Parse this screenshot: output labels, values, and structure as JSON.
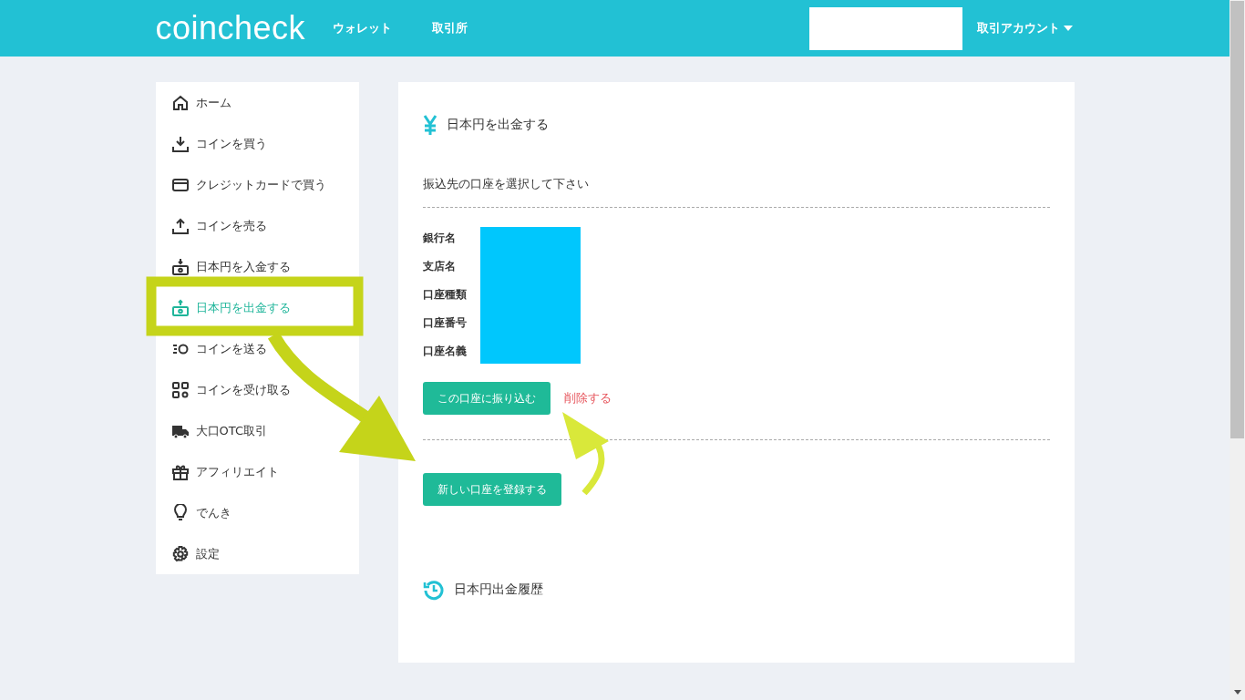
{
  "header": {
    "logo": "coincheck",
    "nav": [
      {
        "label": "ウォレット"
      },
      {
        "label": "取引所"
      }
    ],
    "account_menu": "取引アカウント"
  },
  "sidebar": {
    "items": [
      {
        "kind": "home",
        "label": "ホーム",
        "selected": false
      },
      {
        "kind": "download",
        "label": "コインを買う",
        "selected": false
      },
      {
        "kind": "card",
        "label": "クレジットカードで買う",
        "selected": false
      },
      {
        "kind": "upload",
        "label": "コインを売る",
        "selected": false
      },
      {
        "kind": "deposit",
        "label": "日本円を入金する",
        "selected": false
      },
      {
        "kind": "withdraw",
        "label": "日本円を出金する",
        "selected": true
      },
      {
        "kind": "send",
        "label": "コインを送る",
        "selected": false
      },
      {
        "kind": "qr",
        "label": "コインを受け取る",
        "selected": false
      },
      {
        "kind": "truck",
        "label": "大口OTC取引",
        "selected": false
      },
      {
        "kind": "gift",
        "label": "アフィリエイト",
        "selected": false
      },
      {
        "kind": "bulb",
        "label": "でんき",
        "selected": false
      },
      {
        "kind": "gear",
        "label": "設定",
        "selected": false
      }
    ]
  },
  "panel": {
    "title": "日本円を出金する",
    "instruction": "振込先の口座を選択して下さい",
    "account_fields": [
      "銀行名",
      "支店名",
      "口座種類",
      "口座番号",
      "口座名義"
    ],
    "transfer_button": "この口座に振り込む",
    "delete_link": "削除する",
    "register_button": "新しい口座を登録する",
    "history_title": "日本円出金履歴"
  }
}
